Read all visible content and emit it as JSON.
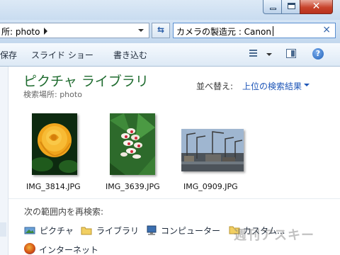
{
  "address": {
    "path": "所: photo"
  },
  "search": {
    "query": "カメラの製造元 : Canon",
    "clear_label": "×"
  },
  "toolbar": {
    "save_label": "保存",
    "slideshow_label": "スライド ショー",
    "burn_label": "書き込む"
  },
  "library": {
    "title": "ピクチャ ライブラリ",
    "location": "検索場所: photo"
  },
  "sort": {
    "label": "並べ替え:",
    "value": "上位の検索結果"
  },
  "files": [
    {
      "name": "IMG_3814.JPG"
    },
    {
      "name": "IMG_3639.JPG"
    },
    {
      "name": "IMG_0909.JPG"
    }
  ],
  "research": {
    "heading": "次の範囲内を再検索:",
    "locations": [
      {
        "label": "ピクチャ",
        "icon": "pictures-icon"
      },
      {
        "label": "ライブラリ",
        "icon": "folder-icon"
      },
      {
        "label": "コンピューター",
        "icon": "computer-icon"
      },
      {
        "label": "カスタム...",
        "icon": "folder-icon"
      },
      {
        "label": "インターネット",
        "icon": "firefox-icon"
      }
    ]
  },
  "watermark": "週刊アスキー"
}
